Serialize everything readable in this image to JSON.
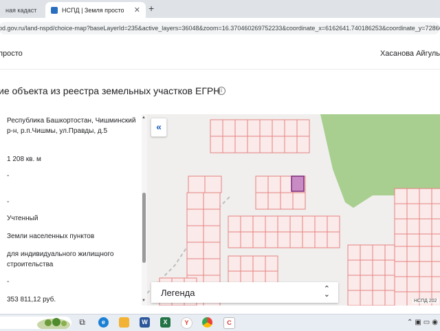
{
  "browser": {
    "tabs": [
      {
        "title": "ная кадаст"
      },
      {
        "title": "НСПД | Земля просто",
        "active": true
      }
    ],
    "url": "pd.gov.ru/land-nspd/choice-map?baseLayerId=235&active_layers=36048&zoom=16.370460269752233&coordinate_x=6162641.740186253&coordinate_y=72866"
  },
  "header": {
    "brand": "просто",
    "user": "Хасанова Айгуль"
  },
  "page": {
    "title": "ие объекта из реестра земельных участков ЕГРН"
  },
  "details": {
    "address": "Республика Башкортостан, Чишминский р-н, р.п.Чишмы, ул.Правды, д.5",
    "area": "1 208 кв. м",
    "dash1": "-",
    "dash2": "-",
    "status": "Учтенный",
    "category": "Земли населенных пунктов",
    "permitted_use": "для индивидуального жилищного строительства",
    "dash3": "-",
    "cadastral_value": "353 811,12 руб."
  },
  "map": {
    "legend_label": "Легенда",
    "attribution": "НСПД 202",
    "colors": {
      "background": "#f0efee",
      "parcel_stroke": "#e5827f",
      "parcel_fill": "#faeaea",
      "selected_fill": "#c98bc4",
      "selected_stroke": "#7b2a7b",
      "forest": "#a8cf8f"
    }
  },
  "icons": {
    "collapse": "double-chevron-left-icon",
    "info": "info-icon",
    "legend_toggle": "chevron-up-down-icon"
  }
}
